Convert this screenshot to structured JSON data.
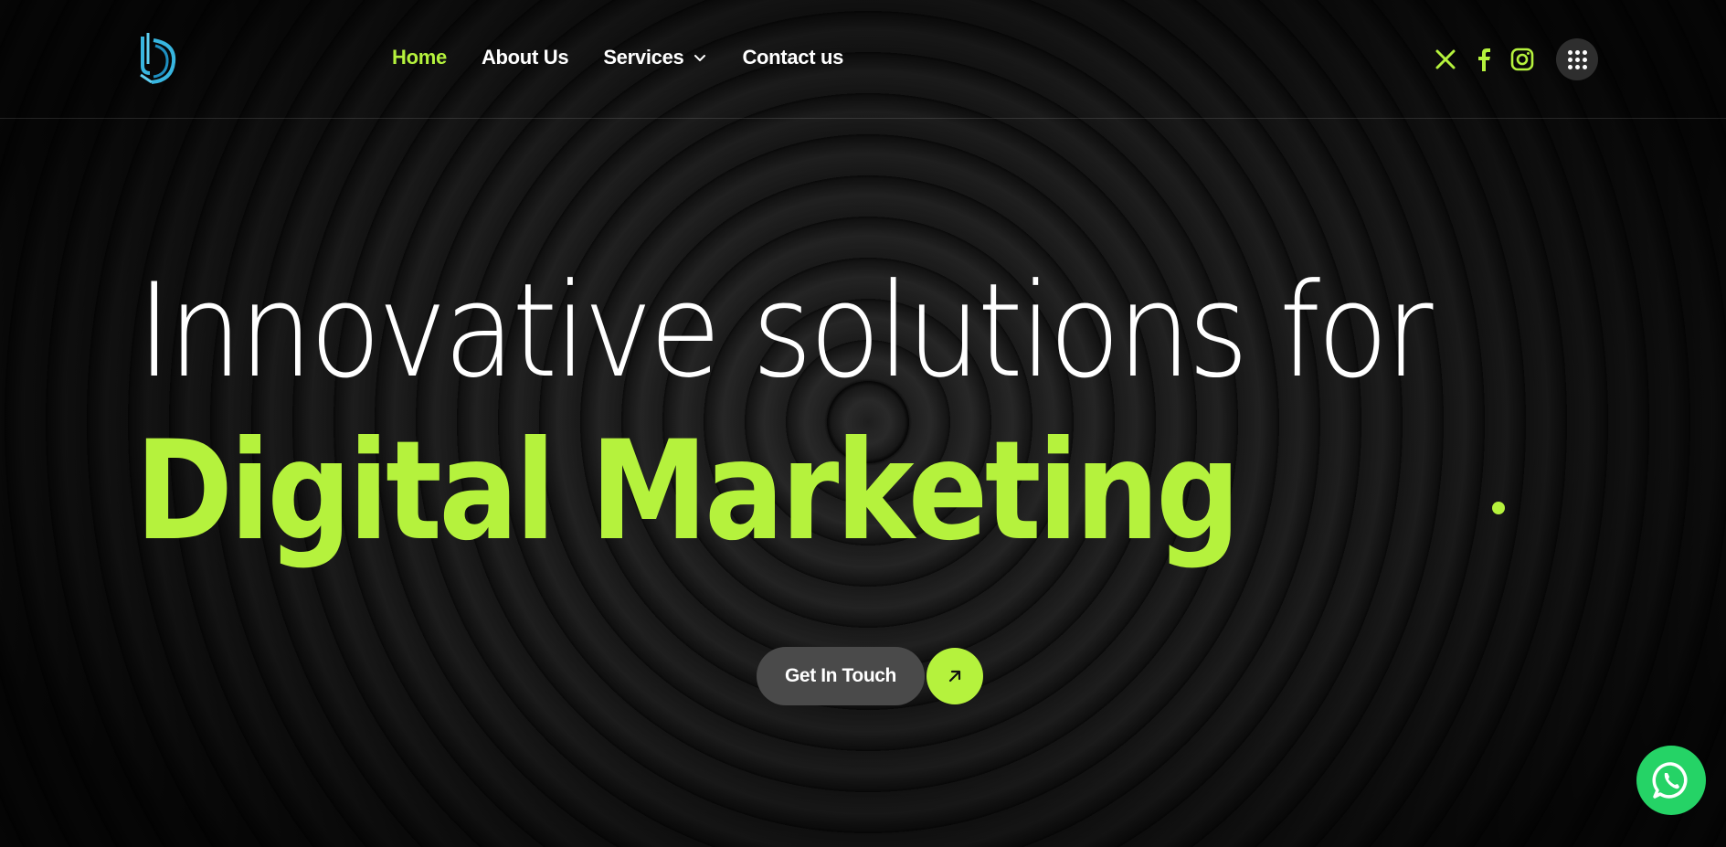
{
  "colors": {
    "accent": "#b5f23d",
    "background": "#121212",
    "whatsapp": "#25d366",
    "logo": "#38b6e0"
  },
  "header": {
    "logo_icon": "brand-logo-icon",
    "nav": [
      {
        "label": "Home",
        "active": true
      },
      {
        "label": "About Us"
      },
      {
        "label": "Services",
        "has_dropdown": true
      },
      {
        "label": "Contact us"
      }
    ],
    "social_icons": [
      "x-twitter-icon",
      "facebook-icon",
      "instagram-icon"
    ],
    "menu_icon": "grid-menu-icon"
  },
  "hero": {
    "headline": "Innovative solutions for",
    "highlight": "Digital Marketing",
    "cta_label": "Get In Touch",
    "cta_icon": "arrow-up-right-icon"
  },
  "floating": {
    "whatsapp_icon": "whatsapp-icon"
  }
}
